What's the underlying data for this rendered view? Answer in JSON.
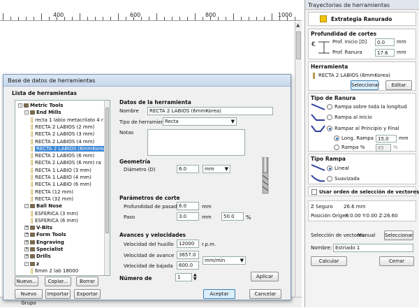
{
  "ruler": {
    "marks": [
      "400",
      "600",
      "800",
      "1000"
    ]
  },
  "panel": {
    "title": "Trayectorias de herramientas",
    "strategy": "Extrategia Ranurado",
    "depth": {
      "heading": "Profundidad de cortes",
      "start_label": "Prof. Inicio [D]",
      "start_value": "0.0",
      "start_unit": "mm",
      "depth_label": "Prof. Ranura",
      "depth_value": "17.6",
      "depth_unit": "mm"
    },
    "tool": {
      "heading": "Herramienta",
      "name": "RECTA 2 LABIOS (6mmKorea)",
      "select_label": "Seleccionar",
      "edit_label": "Editar"
    },
    "slot": {
      "heading": "Tipo de Ranura",
      "opt1": "Rampa sobre toda la longitud",
      "opt2": "Rampa al inicio",
      "opt3": "Rampar al Principio y Final",
      "sub1": "Long. Rampa",
      "sub1_value": "15.0",
      "sub1_unit": "mm",
      "sub2": "Rampa %",
      "sub2_value": "85",
      "sub2_unit": "%"
    },
    "ramp": {
      "heading": "Tipo Rampa",
      "opt1": "Lineal",
      "opt2": "Suavizada"
    },
    "vector_order": "Usar orden de selección de vectores",
    "zsafe_label": "Z Seguro",
    "zsafe_value": "26.6 mm",
    "origin_label": "Posición Origen",
    "origin_value": "X:0.00 Y:0.00 Z:26.60",
    "vecsel_label": "Selección de vectores:",
    "vecsel_value": "Manual",
    "vecsel_button": "Seleccionar",
    "name_label": "Nombre:",
    "name_value": "Estriado 1",
    "calc": "Calcular",
    "close": "Cerrar"
  },
  "dialog": {
    "title": "Base de datos de herramientas",
    "list_heading": "Lista de herramientas",
    "tree": [
      {
        "label": "Metric Tools",
        "level": 0,
        "kind": "folder",
        "expander": "-"
      },
      {
        "label": "End Mills",
        "level": 1,
        "kind": "folder",
        "expander": "-"
      },
      {
        "label": "recta 1 labio metacrilato 4 r",
        "level": 2,
        "kind": "tool"
      },
      {
        "label": "RECTA 2 LABIOS (2 mm)",
        "level": 2,
        "kind": "tool"
      },
      {
        "label": "RECTA 2 LABIOS (3 mm)",
        "level": 2,
        "kind": "tool"
      },
      {
        "label": "RECTA 2 LABIOS (4 mm)",
        "level": 2,
        "kind": "tool"
      },
      {
        "label": "RECTA 2 LABIOS (6mmKorea)",
        "level": 2,
        "kind": "tool",
        "selected": true
      },
      {
        "label": "RECTA 2 LABIOS (6 mm)",
        "level": 2,
        "kind": "tool"
      },
      {
        "label": "RECTA 2 LABIOS (6 mm) ra",
        "level": 2,
        "kind": "tool"
      },
      {
        "label": "RECTA 1 LABIO (3 mm)",
        "level": 2,
        "kind": "tool"
      },
      {
        "label": "RECTA 1 LABIO (4 mm)",
        "level": 2,
        "kind": "tool"
      },
      {
        "label": "RECTA 1 LABIO (6 mm)",
        "level": 2,
        "kind": "tool"
      },
      {
        "label": "RECTA (12 mm)",
        "level": 2,
        "kind": "tool"
      },
      {
        "label": "RECTA (32 mm)",
        "level": 2,
        "kind": "tool"
      },
      {
        "label": "Ball Nose",
        "level": 1,
        "kind": "folder",
        "expander": "-"
      },
      {
        "label": "ESFERICA (3 mm)",
        "level": 2,
        "kind": "tool"
      },
      {
        "label": "ESFERICA (6 mm)",
        "level": 2,
        "kind": "tool"
      },
      {
        "label": "V-Bits",
        "level": 1,
        "kind": "folder",
        "expander": "+"
      },
      {
        "label": "Form Tools",
        "level": 1,
        "kind": "folder",
        "expander": "+"
      },
      {
        "label": "Engraving",
        "level": 1,
        "kind": "folder",
        "expander": "+"
      },
      {
        "label": "Specialist",
        "level": 1,
        "kind": "folder",
        "expander": "+"
      },
      {
        "label": "Drills",
        "level": 1,
        "kind": "folder",
        "expander": "+"
      },
      {
        "label": "z",
        "level": 1,
        "kind": "folder",
        "expander": "-"
      },
      {
        "label": "6mm 2 lab 18000",
        "level": 2,
        "kind": "tool"
      }
    ],
    "btn_new": "Nuevo...",
    "btn_copy": "Copiar...",
    "btn_delete": "Borrar",
    "btn_newgroup": "Nuevo Grupo",
    "btn_import": "Importar",
    "btn_export": "Exportar",
    "data_heading": "Datos de la herramienta",
    "name_label": "Nombre",
    "name_value": "RECTA 2 LABIOS (6mmKorea)",
    "type_label": "Tipo de herramienta",
    "type_value": "Recta",
    "notes_label": "Notas",
    "geom_heading": "Geometría",
    "diam_label": "Diámetro (D)",
    "diam_value": "6.0",
    "diam_unit": "mm",
    "cut_heading": "Parámetros de corte",
    "depth_label": "Profundidad de pasada",
    "depth_value": "6.0",
    "depth_unit": "mm",
    "step_label": "Paso",
    "step_value": "3.0",
    "step_unit": "mm",
    "step_pct": "50.0",
    "step_pct_unit": "%",
    "feed_heading": "Avances y velocidades",
    "spindle_label": "Velocidad del husillo",
    "spindle_value": "12000",
    "spindle_unit": "r.p.m.",
    "feed_label": "Velocidad de avance",
    "feed_value": "3657.0",
    "plunge_label": "Velocidad de bajada",
    "plunge_value": "600.0",
    "rate_unit": "mm/min",
    "number_label": "Número de",
    "number_value": "1",
    "apply": "Aplicar",
    "accept": "Aceptar",
    "cancel": "Cancelar"
  }
}
